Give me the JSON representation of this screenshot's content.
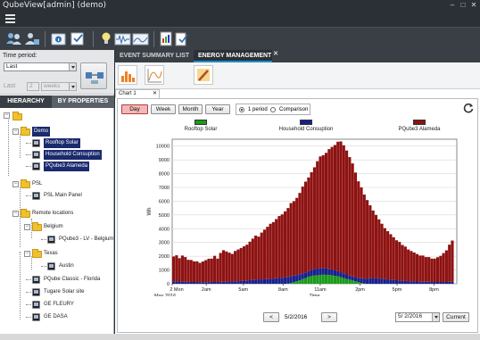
{
  "window": {
    "title": "QubeView[admin] (demo)"
  },
  "colors": {
    "titlebar": "#2b3036",
    "accent_tab": "#1e90c8",
    "highlight": "#1a2a6e"
  },
  "left": {
    "time_period_label": "Time period:",
    "period_value": "Last",
    "last_label": "Last",
    "last_count": "2",
    "last_unit": "weeks",
    "tabs": [
      "HIERARCHY",
      "BY PROPERTIES"
    ],
    "tree": [
      {
        "label": "Demo",
        "level": 1,
        "type": "folder",
        "hl": true
      },
      {
        "label": "Rooftop Solar",
        "level": 2,
        "type": "device",
        "hl": true
      },
      {
        "label": "Household Consuption",
        "level": 2,
        "type": "device",
        "hl": true
      },
      {
        "label": "PQube3 Alameda",
        "level": 2,
        "type": "device",
        "hl": true
      },
      {
        "label": "PSL",
        "level": 1,
        "type": "folder",
        "hl": false
      },
      {
        "label": "PSL Main Panel",
        "level": 2,
        "type": "device",
        "hl": false
      },
      {
        "label": "Remote locations",
        "level": 1,
        "type": "folder",
        "hl": false
      },
      {
        "label": "Belgium",
        "level": 2,
        "type": "folder",
        "hl": false
      },
      {
        "label": "PQube3 - LV - Belgium",
        "level": 3,
        "type": "device",
        "hl": false
      },
      {
        "label": "Texas",
        "level": 2,
        "type": "folder",
        "hl": false
      },
      {
        "label": "Austin",
        "level": 3,
        "type": "device",
        "hl": false
      },
      {
        "label": "PQube Classic - Florida",
        "level": 2,
        "type": "device",
        "hl": false
      },
      {
        "label": "Tugare Solar site",
        "level": 2,
        "type": "device",
        "hl": false
      },
      {
        "label": "GE FLEURY",
        "level": 2,
        "type": "device",
        "hl": false
      },
      {
        "label": "GE DASA",
        "level": 2,
        "type": "device",
        "hl": false
      }
    ]
  },
  "main": {
    "tabs": [
      "EVENT SUMMARY LIST",
      "ENERGY MANAGEMENT"
    ],
    "chart_tab": "Chart 1",
    "period_buttons": [
      "Day",
      "Week",
      "Month",
      "Year"
    ],
    "radio_1": "1 period",
    "radio_2": "Comparison",
    "nav_prev": "<",
    "nav_date": "5/2/2016",
    "nav_next": ">",
    "date_field": "5/ 2/2016",
    "current_button": "Current"
  },
  "chart_data": {
    "type": "bar",
    "stacked": true,
    "ylabel": "Wh",
    "xlabel": "Time",
    "x_date_label": "May 2016",
    "ylim": [
      0,
      10500
    ],
    "yticks": [
      0,
      1000,
      2000,
      3000,
      4000,
      5000,
      6000,
      7000,
      8000,
      9000,
      10000
    ],
    "xtick_labels": [
      "2 Mon",
      "2am",
      "5am",
      "8am",
      "11am",
      "2pm",
      "5pm",
      "8pm"
    ],
    "legend": [
      {
        "name": "Rooftop Solar",
        "color": "#1a9a1a"
      },
      {
        "name": "Household Consuption",
        "color": "#18208a"
      },
      {
        "name": "PQube3 Alameda",
        "color": "#8e1212"
      }
    ],
    "grid": true,
    "series": [
      {
        "name": "Rooftop Solar",
        "color": "#1a9a1a",
        "values": [
          0,
          0,
          0,
          0,
          0,
          0,
          0,
          0,
          0,
          0,
          0,
          0,
          0,
          0,
          0,
          0,
          0,
          0,
          0,
          0,
          0,
          0,
          0,
          0,
          0,
          0,
          0,
          0,
          0,
          0,
          0,
          0,
          0,
          0,
          0,
          0,
          0,
          0,
          0,
          20,
          60,
          120,
          180,
          260,
          340,
          420,
          500,
          560,
          600,
          620,
          650,
          660,
          650,
          640,
          620,
          580,
          540,
          480,
          420,
          360,
          300,
          240,
          180,
          120,
          60,
          20,
          0,
          0,
          0,
          0,
          0,
          0,
          0,
          0,
          0,
          0,
          0,
          0,
          0,
          0,
          0,
          0,
          0,
          0,
          0,
          0,
          0,
          0,
          0,
          0,
          0,
          0,
          0,
          0,
          0,
          0,
          0
        ]
      },
      {
        "name": "Household Consuption",
        "color": "#18208a",
        "values": [
          180,
          170,
          160,
          150,
          140,
          140,
          130,
          130,
          130,
          120,
          120,
          120,
          120,
          130,
          130,
          130,
          140,
          140,
          150,
          160,
          170,
          180,
          190,
          200,
          220,
          240,
          260,
          280,
          300,
          320,
          320,
          330,
          340,
          360,
          380,
          400,
          420,
          440,
          460,
          480,
          500,
          480,
          460,
          440,
          420,
          400,
          420,
          440,
          460,
          480,
          500,
          480,
          460,
          440,
          420,
          400,
          380,
          360,
          340,
          320,
          300,
          300,
          300,
          320,
          340,
          360,
          380,
          400,
          420,
          400,
          380,
          360,
          340,
          320,
          300,
          280,
          260,
          240,
          220,
          200,
          190,
          180,
          170,
          160,
          150,
          150,
          140,
          140,
          130,
          130,
          130,
          130,
          130,
          130,
          140,
          140
        ]
      },
      {
        "name": "PQube3 Alameda",
        "color": "#8e1212",
        "values": [
          1800,
          1900,
          1700,
          1900,
          1800,
          1600,
          1600,
          1500,
          1500,
          1400,
          1500,
          1600,
          1700,
          1700,
          1900,
          1700,
          2100,
          2300,
          2200,
          2100,
          2000,
          2200,
          2300,
          2400,
          2500,
          2600,
          2800,
          3000,
          3200,
          3100,
          3400,
          3600,
          3800,
          4000,
          4100,
          4300,
          4500,
          4600,
          4800,
          5000,
          5300,
          5400,
          5600,
          5900,
          6300,
          6600,
          6800,
          7100,
          7400,
          7800,
          8100,
          8200,
          8400,
          8700,
          8900,
          9100,
          9400,
          9500,
          9300,
          9000,
          8600,
          8200,
          7600,
          7000,
          6600,
          6100,
          5700,
          5300,
          4900,
          4600,
          4300,
          4000,
          3700,
          3500,
          3300,
          3100,
          2900,
          2800,
          2600,
          2500,
          2300,
          2200,
          2100,
          2000,
          1900,
          1900,
          1800,
          1800,
          1700,
          1700,
          1800,
          1900,
          2100,
          2300,
          2700,
          3000,
          3100
        ]
      }
    ]
  }
}
